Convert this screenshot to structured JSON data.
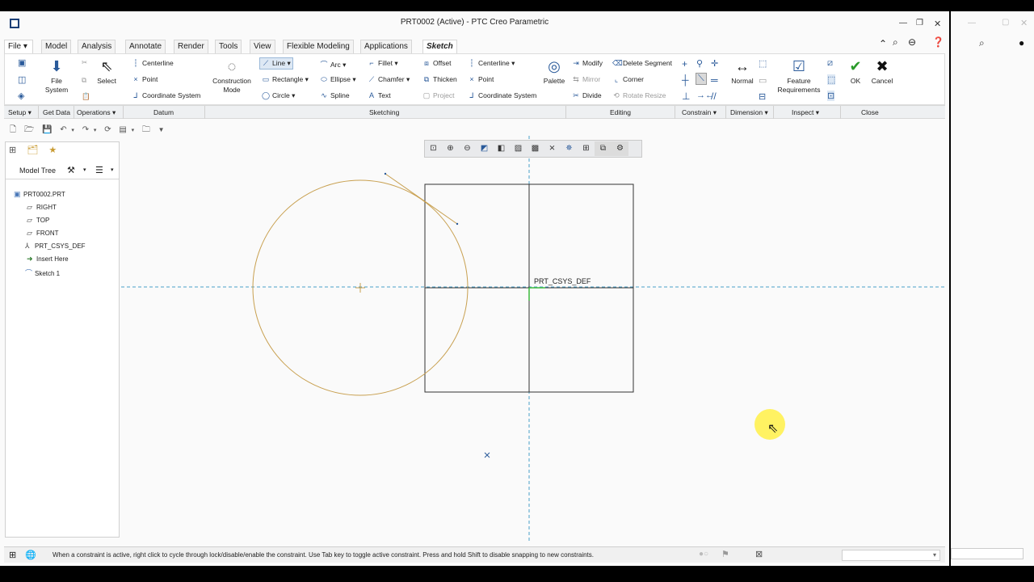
{
  "window": {
    "title": "PRT0002 (Active) - PTC Creo Parametric"
  },
  "tabs": [
    "File",
    "Model",
    "Analysis",
    "Annotate",
    "Render",
    "Tools",
    "View",
    "Flexible Modeling",
    "Applications",
    "Sketch"
  ],
  "ribbon": {
    "file_system": "File\nSystem",
    "select": "Select",
    "datum": {
      "centerline": "Centerline",
      "point": "Point",
      "coordinate_system": "Coordinate System"
    },
    "construction_mode": "Construction\nMode",
    "sketching": {
      "line": "Line",
      "rectangle": "Rectangle",
      "circle": "Circle",
      "arc": "Arc",
      "ellipse": "Ellipse",
      "spline": "Spline",
      "fillet": "Fillet",
      "chamfer": "Chamfer",
      "text": "Text",
      "offset": "Offset",
      "thicken": "Thicken",
      "project": "Project",
      "centerline": "Centerline",
      "point": "Point",
      "coordinate_system": "Coordinate System",
      "palette": "Palette"
    },
    "editing": {
      "modify": "Modify",
      "mirror": "Mirror",
      "divide": "Divide",
      "delete_segment": "Delete Segment",
      "corner": "Corner",
      "rotate_resize": "Rotate Resize"
    },
    "dimension": {
      "normal": "Normal"
    },
    "inspect": {
      "feature_requirements": "Feature\nRequirements"
    },
    "close": {
      "ok": "OK",
      "cancel": "Cancel"
    }
  },
  "groups": {
    "setup": "Setup",
    "get_data": "Get Data",
    "operations": "Operations",
    "datum": "Datum",
    "sketching": "Sketching",
    "editing": "Editing",
    "constrain": "Constrain",
    "dimension": "Dimension",
    "inspect": "Inspect",
    "close": "Close"
  },
  "model_tree": {
    "title": "Model Tree",
    "items": [
      "PRT0002.PRT",
      "RIGHT",
      "TOP",
      "FRONT",
      "PRT_CSYS_DEF",
      "Insert Here",
      "Sketch 1"
    ]
  },
  "canvas": {
    "csys_label": "PRT_CSYS_DEF"
  },
  "status": {
    "message": "When a constraint is active, right click to cycle through lock/disable/enable the constraint. Use Tab key to toggle active constraint. Press and hold Shift to disable snapping to new constraints."
  },
  "colors": {
    "sketch_geometry": "#c8a050",
    "datum_line": "#4aa0c8",
    "accent_blue": "#2a5a9a",
    "ok_green": "#2a9a2a"
  }
}
